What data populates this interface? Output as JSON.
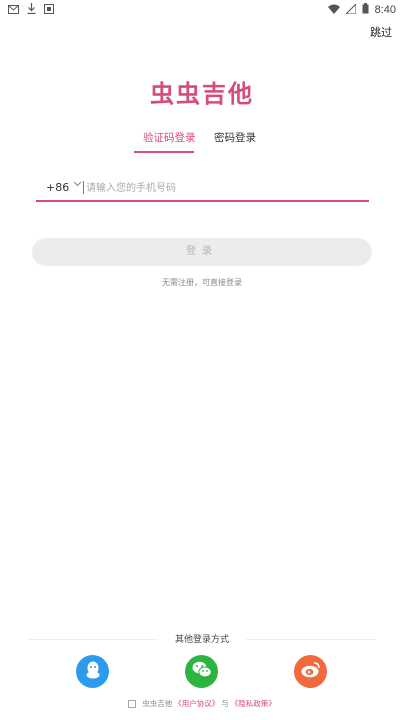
{
  "status_bar": {
    "time": "8:40",
    "left_icons": [
      "mail-icon",
      "download-icon",
      "app-icon"
    ],
    "right_icons": [
      "wifi-icon",
      "signal-icon",
      "battery-icon"
    ]
  },
  "header": {
    "skip_label": "跳过"
  },
  "app": {
    "title": "虫虫吉他"
  },
  "tabs": [
    {
      "label": "验证码登录",
      "active": true
    },
    {
      "label": "密码登录",
      "active": false
    }
  ],
  "phone": {
    "country_code": "+86",
    "placeholder": "请输入您的手机号码",
    "value": ""
  },
  "login_button": {
    "label": "登录"
  },
  "hint": "无需注册，可直接登录",
  "other_login": {
    "title": "其他登录方式",
    "providers": [
      {
        "name": "qq",
        "icon": "qq-icon",
        "color": "#2c9bec"
      },
      {
        "name": "wechat",
        "icon": "wechat-icon",
        "color": "#2bb43f"
      },
      {
        "name": "weibo",
        "icon": "weibo-icon",
        "color": "#f16a3e"
      }
    ]
  },
  "agreement": {
    "prefix": "虫虫吉他",
    "user_agreement": "《用户协议》",
    "conjunction": "与",
    "privacy_policy": "《隐私政策》"
  },
  "colors": {
    "accent": "#d64c7b",
    "button_bg": "#ececec"
  }
}
